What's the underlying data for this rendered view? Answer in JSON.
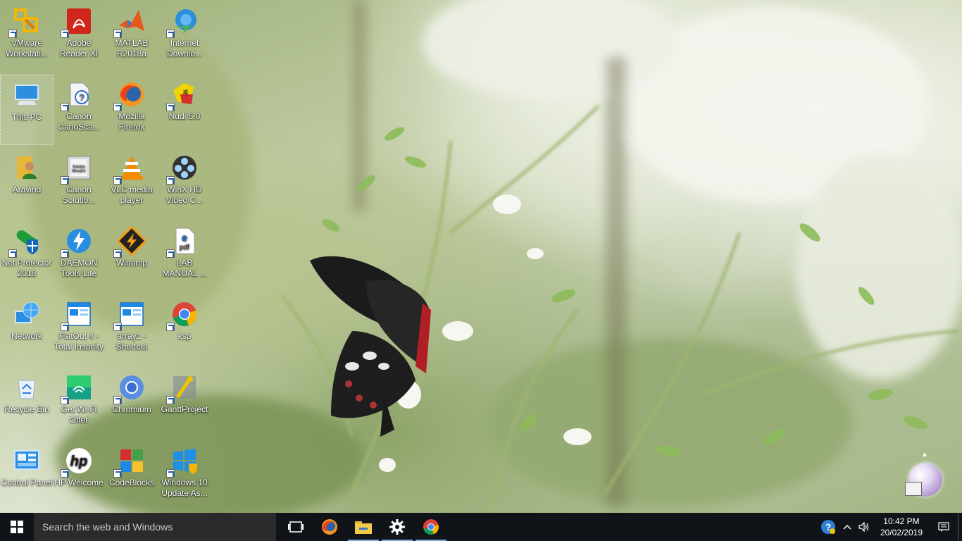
{
  "desktop": {
    "icons": [
      {
        "label": "VMware Workstati...",
        "icon": "vmware-icon"
      },
      {
        "label": "Adobe Reader XI",
        "icon": "adobe-reader-icon"
      },
      {
        "label": "MATLAB R2018a",
        "icon": "matlab-icon"
      },
      {
        "label": "Internet Downlo...",
        "icon": "internet-download-manager-icon"
      },
      {
        "label": "This PC",
        "icon": "this-pc-icon"
      },
      {
        "label": "Canon CanoSca...",
        "icon": "canon-canoscan-icon"
      },
      {
        "label": "Mozilla Firefox",
        "icon": "firefox-icon"
      },
      {
        "label": "Nudi 5.0",
        "icon": "nudi-icon"
      },
      {
        "label": "Aravind",
        "icon": "user-folder-icon"
      },
      {
        "label": "Canon Solutio...",
        "icon": "canon-solution-menu-icon"
      },
      {
        "label": "VLC media player",
        "icon": "vlc-icon"
      },
      {
        "label": "WinX HD Video C...",
        "icon": "winx-video-converter-icon"
      },
      {
        "label": "Net Protector 2018",
        "icon": "net-protector-icon"
      },
      {
        "label": "DAEMON Tools Lite",
        "icon": "daemon-tools-icon"
      },
      {
        "label": "Winamp",
        "icon": "winamp-icon"
      },
      {
        "label": "LAB MANUAL ...",
        "icon": "pdf-document-icon"
      },
      {
        "label": "Network",
        "icon": "network-icon"
      },
      {
        "label": "FlatOut 4 - Total Insanity",
        "icon": "flatout-game-icon"
      },
      {
        "label": "array1 - Shortcut",
        "icon": "array-shortcut-icon"
      },
      {
        "label": "ksp",
        "icon": "chrome-icon"
      },
      {
        "label": "Recycle Bin",
        "icon": "recycle-bin-icon"
      },
      {
        "label": "Get Wi-Fi Offer",
        "icon": "wifi-offer-icon"
      },
      {
        "label": "Chromium",
        "icon": "chromium-icon"
      },
      {
        "label": "GanttProject",
        "icon": "ganttproject-icon"
      },
      {
        "label": "Control Panel",
        "icon": "control-panel-icon"
      },
      {
        "label": "HP Welcome",
        "icon": "hp-icon"
      },
      {
        "label": "CodeBlocks",
        "icon": "codeblocks-icon"
      },
      {
        "label": "Windows 10 Update As...",
        "icon": "windows-update-icon"
      }
    ]
  },
  "taskbar": {
    "search_placeholder": "Search the web and Windows",
    "pinned": [
      {
        "name": "task-view-button",
        "icon": "task-view-icon"
      },
      {
        "name": "firefox-taskbar-button",
        "icon": "firefox-icon"
      },
      {
        "name": "file-explorer-taskbar-button",
        "icon": "folder-icon"
      },
      {
        "name": "settings-taskbar-button",
        "icon": "gear-icon"
      },
      {
        "name": "chrome-taskbar-button",
        "icon": "chrome-icon"
      }
    ],
    "clock": {
      "time": "10:42 PM",
      "date": "20/02/2019"
    }
  },
  "colors": {
    "taskbar_bg": "#101418",
    "search_bg": "#2b2b2b",
    "accent": "#7aa7d9"
  }
}
